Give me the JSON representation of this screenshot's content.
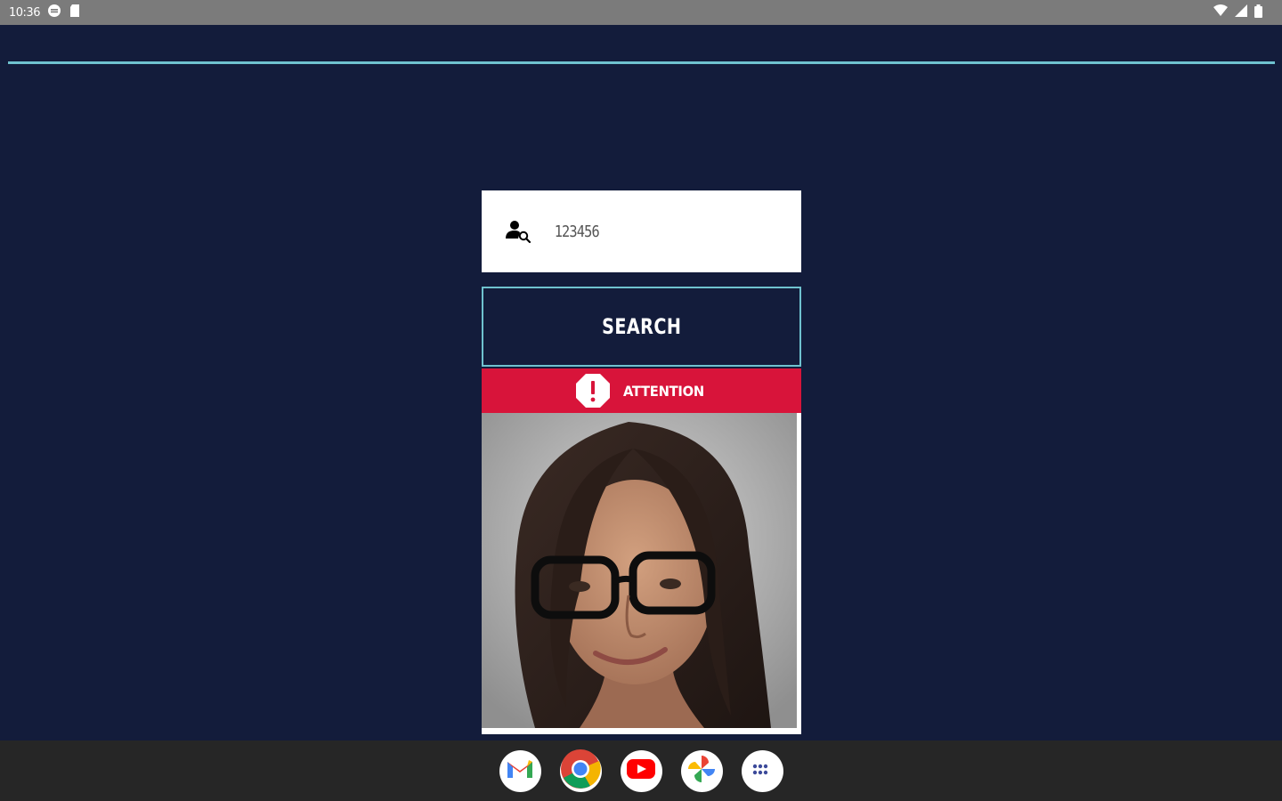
{
  "status_bar": {
    "time": "10:36",
    "left_icons": [
      "sync-icon",
      "sd-card-icon"
    ],
    "right_icons": [
      "wifi-icon",
      "cell-signal-icon",
      "battery-icon"
    ]
  },
  "colors": {
    "background": "#131c3b",
    "accent": "#6fc2cf",
    "alert": "#d8143a",
    "taskbar": "#262626"
  },
  "search": {
    "value": "123456",
    "icon": "person-search-icon"
  },
  "search_button": {
    "label": "SEARCH"
  },
  "alert_banner": {
    "label": "ATTENTION",
    "icon": "exclamation-octagon-icon"
  },
  "result": {
    "image": "person-photo"
  },
  "dock": {
    "apps": [
      "gmail-icon",
      "chrome-icon",
      "youtube-icon",
      "photos-icon",
      "app-drawer-icon"
    ]
  }
}
